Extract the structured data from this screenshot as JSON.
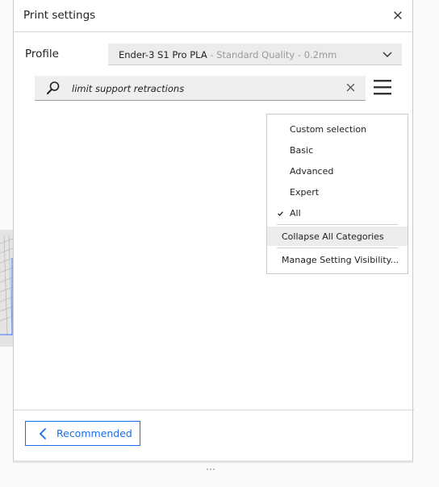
{
  "window": {
    "title": "Print settings",
    "close_icon": "close-icon"
  },
  "profile": {
    "label": "Profile",
    "printer_material": "Ender-3 S1 Pro PLA",
    "quality": " - Standard Quality - 0.2mm"
  },
  "search": {
    "value": "limit support retractions",
    "icon": "search-icon"
  },
  "visibility_menu": {
    "levels": [
      {
        "label": "Custom selection",
        "checked": false
      },
      {
        "label": "Basic",
        "checked": false
      },
      {
        "label": "Advanced",
        "checked": false
      },
      {
        "label": "Expert",
        "checked": false
      },
      {
        "label": "All",
        "checked": true
      }
    ],
    "collapse_label": "Collapse All Categories",
    "manage_label": "Manage Setting Visibility..."
  },
  "footer": {
    "recommended_label": "Recommended"
  },
  "colors": {
    "accent": "#196ef0",
    "panel_bg": "#ffffff",
    "input_bg": "#efefef"
  }
}
